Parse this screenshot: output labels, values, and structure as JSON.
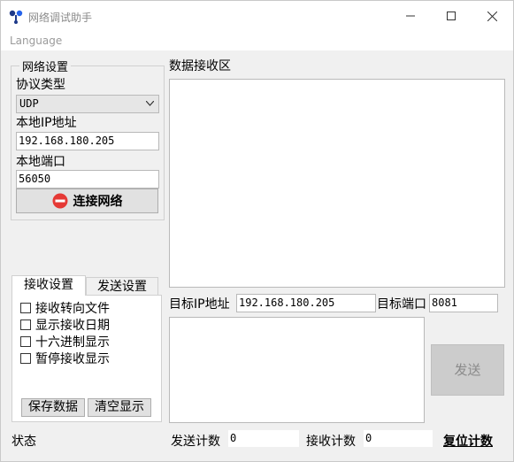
{
  "window": {
    "title": "网络调试助手"
  },
  "menu": {
    "language": "Language"
  },
  "network": {
    "group_title": "网络设置",
    "protocol_label": "协议类型",
    "protocol_value": "UDP",
    "local_ip_label": "本地IP地址",
    "local_ip_value": "192.168.180.205",
    "local_port_label": "本地端口",
    "local_port_value": "56050",
    "connect_label": "连接网络"
  },
  "tabs": {
    "recv": "接收设置",
    "send": "发送设置"
  },
  "recv_options": {
    "items": [
      "接收转向文件",
      "显示接收日期",
      "十六进制显示",
      "暂停接收显示"
    ],
    "save_label": "保存数据",
    "clear_label": "清空显示"
  },
  "recv_area": {
    "title": "数据接收区"
  },
  "target": {
    "ip_label": "目标IP地址",
    "ip_value": "192.168.180.205",
    "port_label": "目标端口",
    "port_value": "8081"
  },
  "send": {
    "button_label": "发送"
  },
  "status": {
    "label": "状态",
    "send_count_label": "发送计数",
    "send_count_value": "0",
    "recv_count_label": "接收计数",
    "recv_count_value": "0",
    "reset_label": "复位计数"
  },
  "colors": {
    "stop_icon": "#e53935",
    "window_bg": "#f0f0f0"
  }
}
